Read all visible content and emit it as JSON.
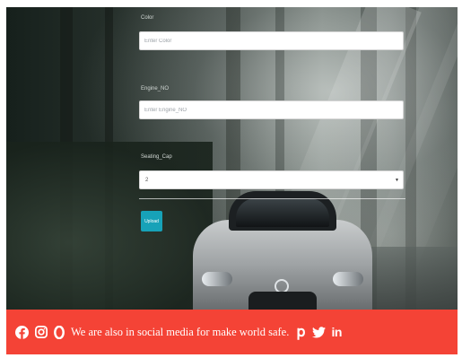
{
  "form": {
    "color_label": "Color",
    "color_placeholder": "Enter Color",
    "engine_label": "Engine_NO",
    "engine_placeholder": "Enter Engine_NO",
    "seating_label": "Seating_Cap",
    "seating_value": "2",
    "upload_label": "Upload"
  },
  "footer": {
    "text": "We are also in social media for make world safe.",
    "background_color": "#f44336",
    "icons": [
      "facebook-icon",
      "instagram-icon",
      "opera-icon",
      "pinterest-icon",
      "twitter-icon",
      "linkedin-icon"
    ]
  },
  "colors": {
    "button": "#17a2b8",
    "footer": "#f44336"
  }
}
